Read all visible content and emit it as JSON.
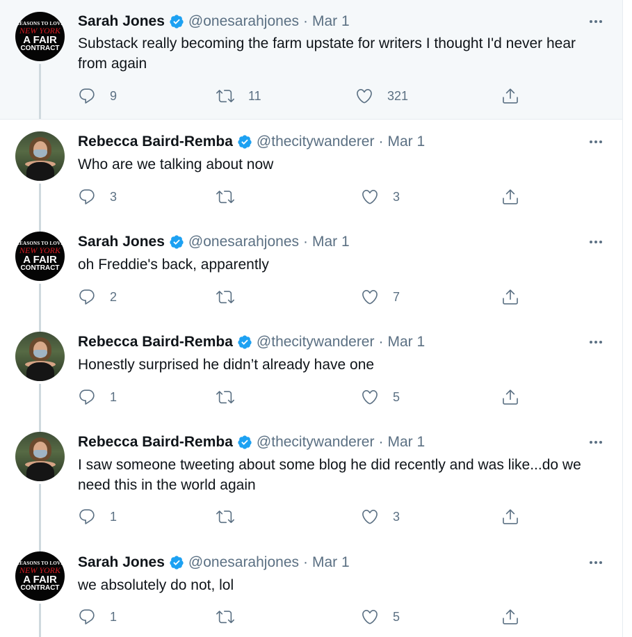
{
  "tweets": [
    {
      "author": "Sarah Jones",
      "handle": "@onesarahjones",
      "separator": "·",
      "date": "Mar 1",
      "text": "Substack really becoming the farm upstate for writers I thought I'd never hear from again",
      "replies": "9",
      "retweets": "11",
      "likes": "321",
      "avatar_lines": [
        "REASONS TO LOVE",
        "NEW YORK",
        "A FAIR",
        "CONTRACT"
      ]
    },
    {
      "author": "Rebecca Baird-Remba",
      "handle": "@thecitywanderer",
      "separator": "·",
      "date": "Mar 1",
      "text": "Who are we talking about now",
      "replies": "3",
      "retweets": "",
      "likes": "3"
    },
    {
      "author": "Sarah Jones",
      "handle": "@onesarahjones",
      "separator": "·",
      "date": "Mar 1",
      "text": "oh Freddie's back, apparently",
      "replies": "2",
      "retweets": "",
      "likes": "7",
      "avatar_lines": [
        "REASONS TO LOVE",
        "NEW YORK",
        "A FAIR",
        "CONTRACT"
      ]
    },
    {
      "author": "Rebecca Baird-Remba",
      "handle": "@thecitywanderer",
      "separator": "·",
      "date": "Mar 1",
      "text": "Honestly surprised he didn’t already have one",
      "replies": "1",
      "retweets": "",
      "likes": "5"
    },
    {
      "author": "Rebecca Baird-Remba",
      "handle": "@thecitywanderer",
      "separator": "·",
      "date": "Mar 1",
      "text": "I saw someone tweeting about some blog he did recently and was like...do we need this in the world again",
      "replies": "1",
      "retweets": "",
      "likes": "3"
    },
    {
      "author": "Sarah Jones",
      "handle": "@onesarahjones",
      "separator": "·",
      "date": "Mar 1",
      "text": "we absolutely do not, lol",
      "replies": "1",
      "retweets": "",
      "likes": "5",
      "avatar_lines": [
        "REASONS TO LOVE",
        "NEW YORK",
        "A FAIR",
        "CONTRACT"
      ]
    }
  ],
  "icons": {
    "verified": "verified-badge-icon",
    "more": "more-options-icon",
    "reply": "reply-icon",
    "retweet": "retweet-icon",
    "like": "like-icon",
    "share": "share-icon"
  },
  "colors": {
    "verified": "#1da1f2",
    "secondary_text": "#5b7083",
    "highlight_bg": "#f5f8fa",
    "thread_line": "#cfd9de"
  }
}
